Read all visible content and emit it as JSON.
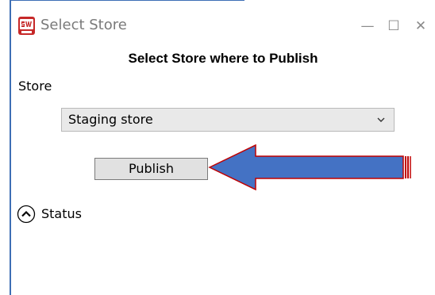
{
  "window": {
    "title": "Select Store",
    "app_icon": "sw-app-icon",
    "controls": {
      "minimize": "—",
      "maximize": "☐",
      "close": "✕"
    }
  },
  "dialog": {
    "heading": "Select Store where to Publish",
    "store_label": "Store",
    "store_select": {
      "value": "Staging store",
      "icon": "chevron-down-icon"
    },
    "publish_button_label": "Publish",
    "status_label": "Status",
    "status_icon": "chevron-up-circle-icon"
  },
  "annotation": {
    "arrow_icon": "left-arrow-callout",
    "arrow_fill": "#4472c4",
    "arrow_stroke": "#c00000"
  },
  "colors": {
    "frame": "#3d6fb5",
    "select_bg": "#e9e9e9",
    "button_bg": "#e1e1e1"
  }
}
